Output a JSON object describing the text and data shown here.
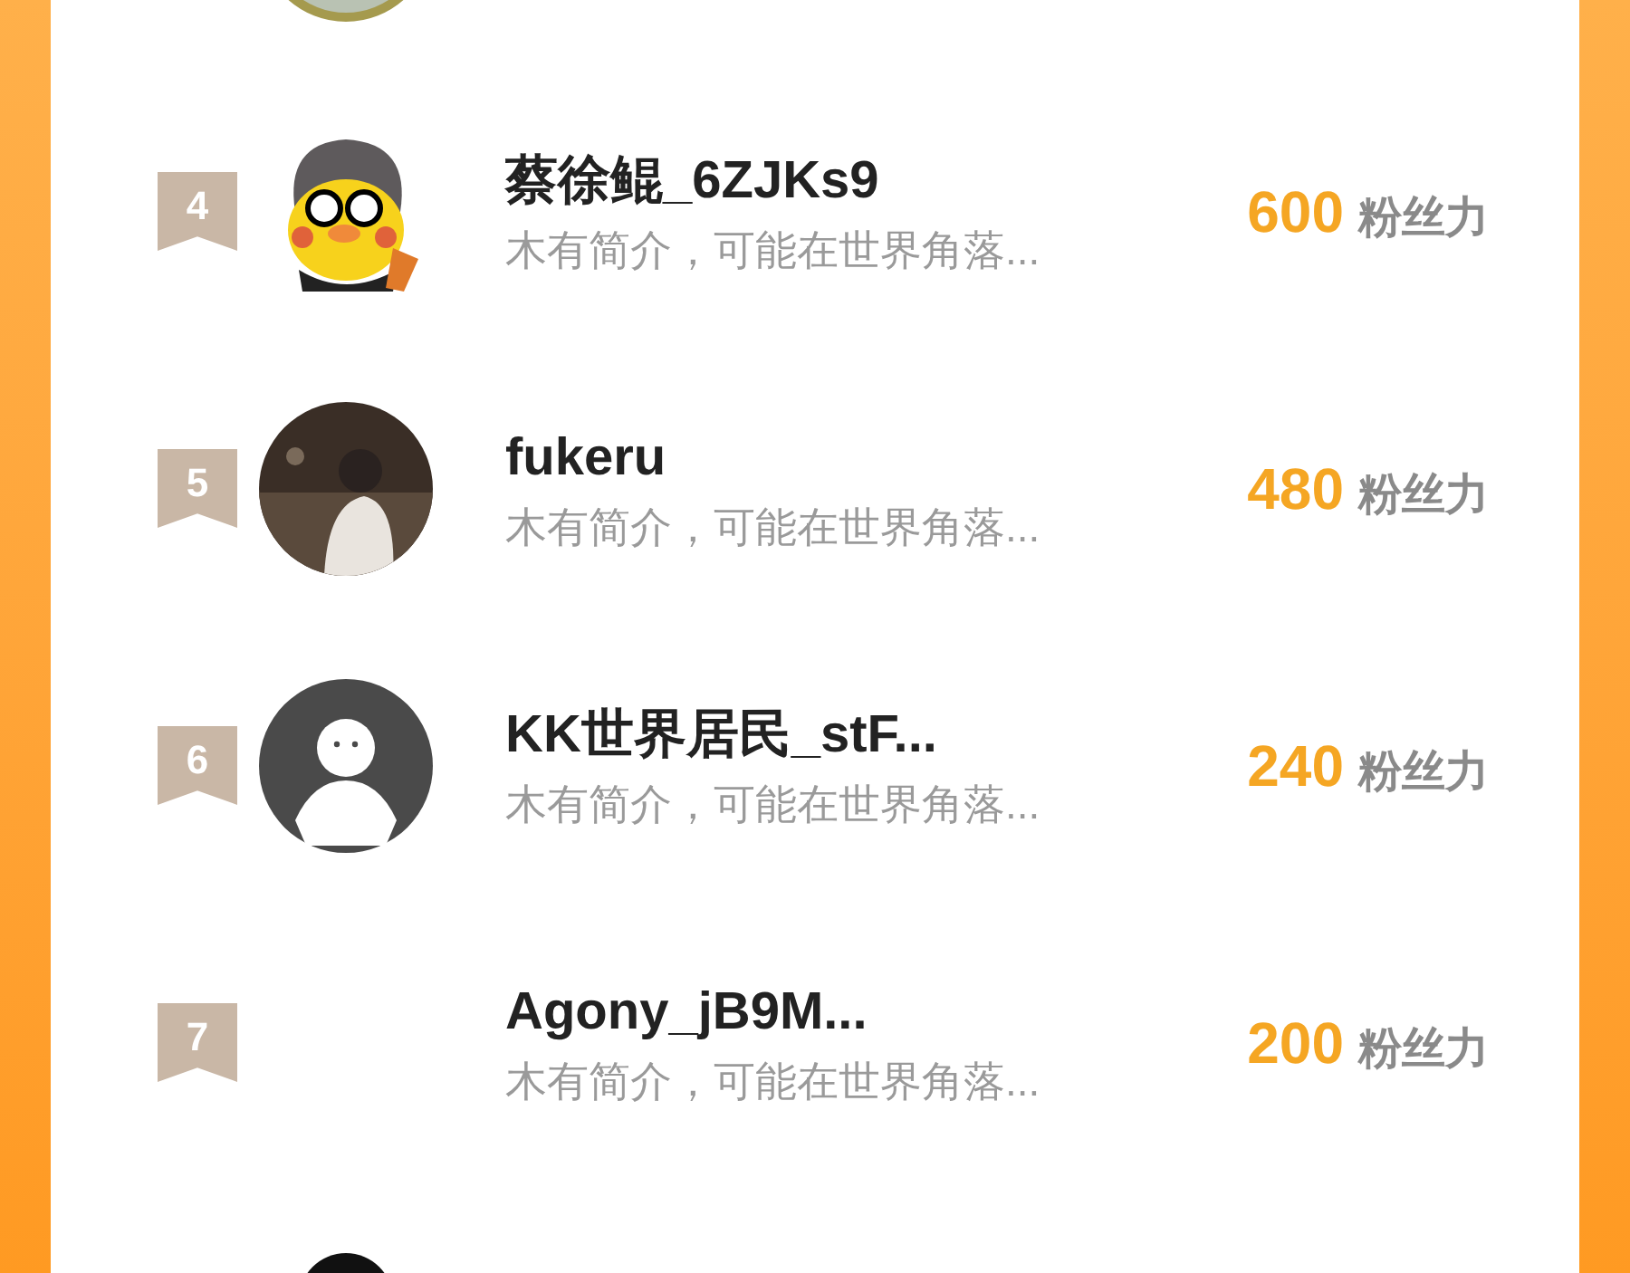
{
  "rows": [
    {
      "avatar": {
        "kind": "ring"
      }
    },
    {
      "rank": "4",
      "avatar": {
        "kind": "duck"
      },
      "name": "蔡徐鲲_6ZJKs9",
      "bio": "木有简介，可能在世界角落...",
      "score": "600",
      "unit": "粉丝力"
    },
    {
      "rank": "5",
      "name": "fukeru",
      "bio": "木有简介，可能在世界角落...",
      "score": "480",
      "unit": "粉丝力"
    },
    {
      "rank": "6",
      "avatar": {
        "kind": "default"
      },
      "name": "KK世界居民_stF...",
      "bio": "木有简介，可能在世界角落...",
      "score": "240",
      "unit": "粉丝力"
    },
    {
      "rank": "7",
      "avatar": {
        "kind": "none"
      },
      "name": "Agony_jB9M...",
      "bio": "木有简介，可能在世界角落...",
      "score": "200",
      "unit": "粉丝力"
    },
    {
      "avatar": {
        "kind": "blob"
      }
    }
  ]
}
